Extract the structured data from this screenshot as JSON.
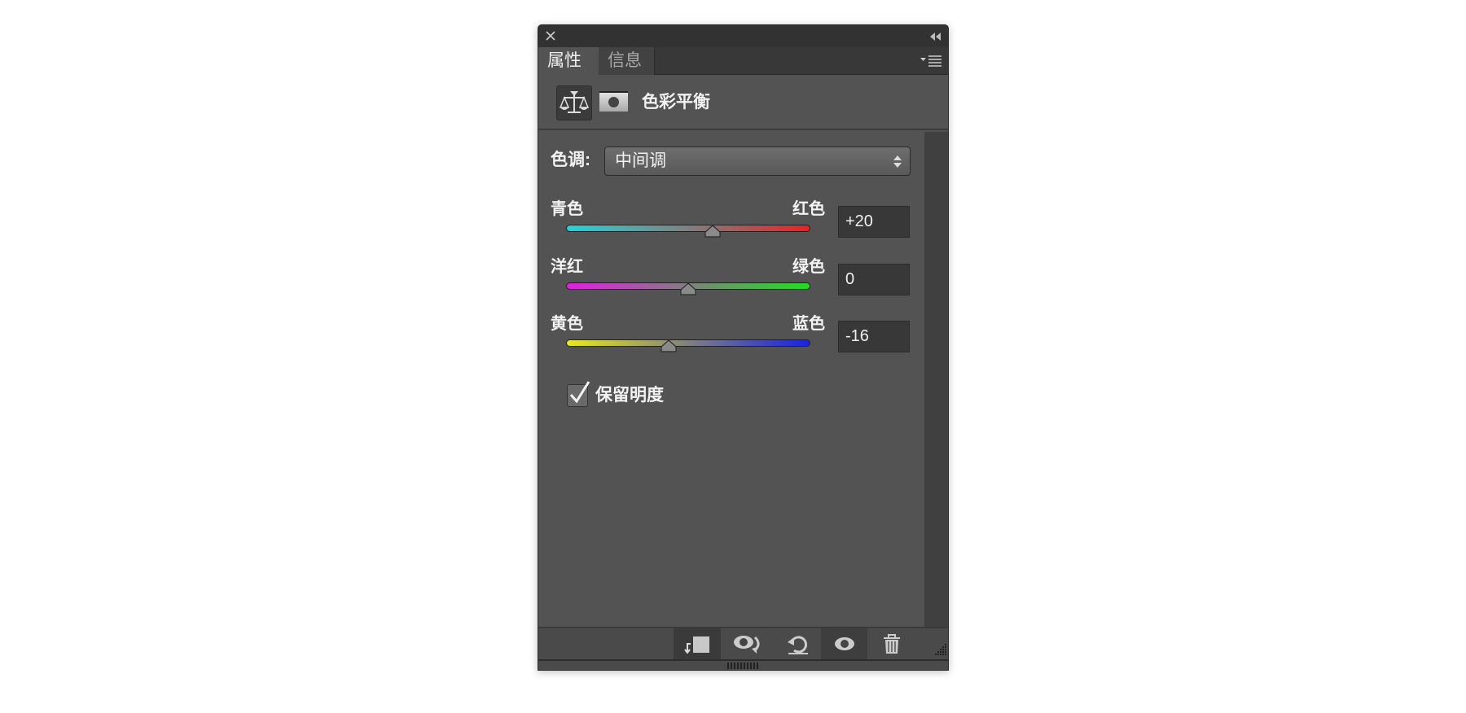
{
  "panel": {
    "tabs": [
      {
        "label": "属性",
        "active": true
      },
      {
        "label": "信息",
        "active": false
      }
    ],
    "title": "色彩平衡",
    "header_icons": [
      "color-balance-icon",
      "mask-icon"
    ],
    "tone": {
      "label": "色调:",
      "value": "中间调"
    },
    "sliders": [
      {
        "left": "青色",
        "right": "红色",
        "value": "+20",
        "level": 20,
        "from": "#22d3d8",
        "to": "#e82222"
      },
      {
        "left": "洋红",
        "right": "绿色",
        "value": "0",
        "level": 0,
        "from": "#e020e0",
        "to": "#22dd22"
      },
      {
        "left": "黄色",
        "right": "蓝色",
        "value": "-16",
        "level": -16,
        "from": "#e8e822",
        "to": "#1a22e0"
      }
    ],
    "slider_range": [
      -100,
      100
    ],
    "preserve_luminosity": {
      "label": "保留明度",
      "checked": true
    },
    "footer_icons": [
      "clip-to-layer-icon",
      "view-previous-icon",
      "reset-icon",
      "visibility-icon",
      "trash-icon"
    ]
  }
}
